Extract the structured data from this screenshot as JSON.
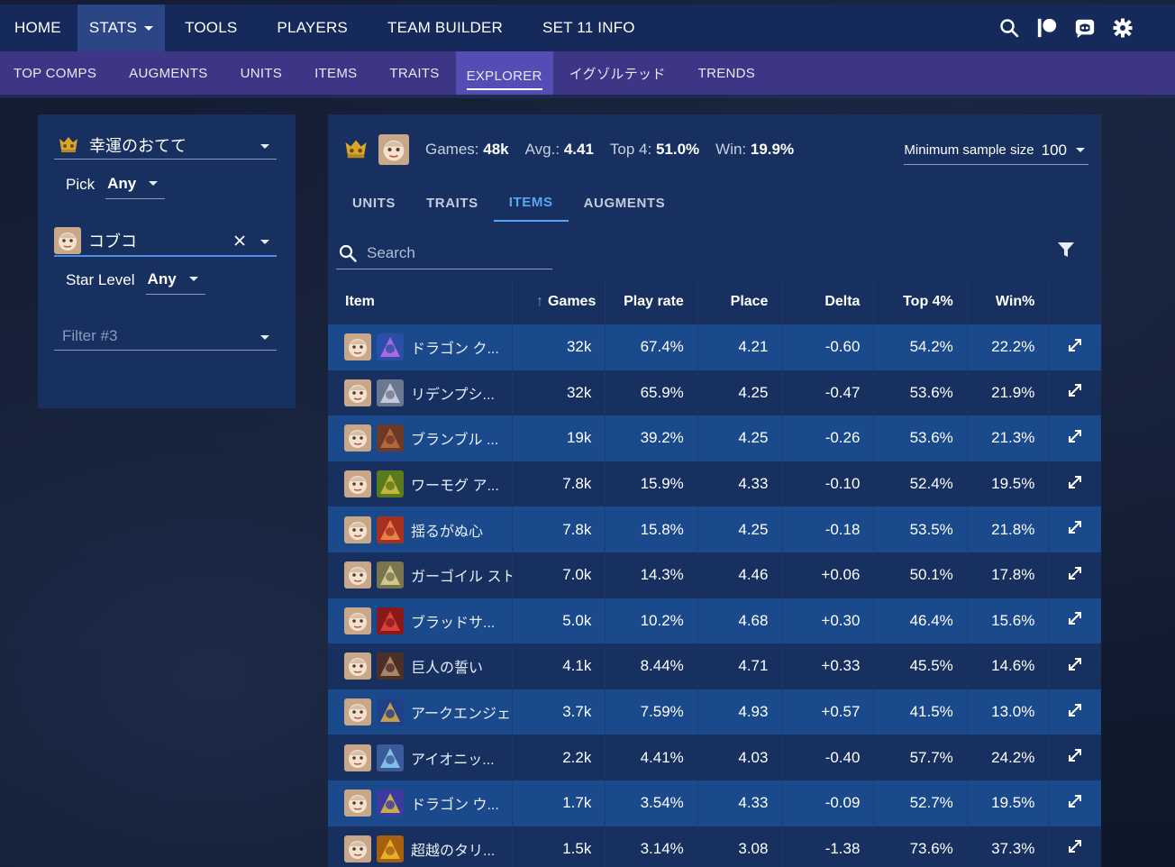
{
  "topnav": {
    "items": [
      {
        "label": "HOME",
        "active": false
      },
      {
        "label": "STATS",
        "active": true
      },
      {
        "label": "TOOLS",
        "active": false
      },
      {
        "label": "PLAYERS",
        "active": false
      },
      {
        "label": "TEAM BUILDER",
        "active": false
      },
      {
        "label": "SET 11 INFO",
        "active": false
      }
    ],
    "icons": [
      "search-icon",
      "patreon-icon",
      "discord-icon",
      "gear-icon"
    ]
  },
  "subnav": {
    "items": [
      {
        "label": "TOP COMPS",
        "active": false
      },
      {
        "label": "AUGMENTS",
        "active": false
      },
      {
        "label": "UNITS",
        "active": false
      },
      {
        "label": "ITEMS",
        "active": false
      },
      {
        "label": "TRAITS",
        "active": false
      },
      {
        "label": "EXPLORER",
        "active": true
      },
      {
        "label": "イグゾルテッド",
        "active": false
      },
      {
        "label": "TRENDS",
        "active": false
      }
    ]
  },
  "filters": {
    "trait_select": "幸運のおてて",
    "pick_label": "Pick",
    "pick_value": "Any",
    "unit_select": "コブコ",
    "star_label": "Star Level",
    "star_value": "Any",
    "filter3_placeholder": "Filter #3"
  },
  "summary": {
    "games_label": "Games:",
    "games_value": "48k",
    "avg_label": "Avg.:",
    "avg_value": "4.41",
    "top4_label": "Top 4:",
    "top4_value": "51.0%",
    "win_label": "Win:",
    "win_value": "19.9%",
    "min_sample_label": "Minimum sample size",
    "min_sample_value": "100"
  },
  "tabs": [
    {
      "label": "UNITS",
      "active": false
    },
    {
      "label": "TRAITS",
      "active": false
    },
    {
      "label": "ITEMS",
      "active": true
    },
    {
      "label": "AUGMENTS",
      "active": false
    }
  ],
  "search": {
    "placeholder": "Search",
    "value": ""
  },
  "table": {
    "headers": {
      "item": "Item",
      "games": "Games",
      "playrate": "Play rate",
      "place": "Place",
      "delta": "Delta",
      "top4": "Top 4%",
      "win": "Win%"
    },
    "sort_column": "games",
    "rows": [
      {
        "name": "ドラゴン ク...",
        "games": "32k",
        "playrate": "67.4%",
        "place": "4.21",
        "delta": "-0.60",
        "top4": "54.2%",
        "win": "22.2%",
        "icon_color": "#2b4fa8",
        "icon_accent": "#c070e0"
      },
      {
        "name": "リデンプシ...",
        "games": "32k",
        "playrate": "65.9%",
        "place": "4.25",
        "delta": "-0.47",
        "top4": "53.6%",
        "win": "21.9%",
        "icon_color": "#6a7890",
        "icon_accent": "#d8d8e8"
      },
      {
        "name": "ブランブル ...",
        "games": "19k",
        "playrate": "39.2%",
        "place": "4.25",
        "delta": "-0.26",
        "top4": "53.6%",
        "win": "21.3%",
        "icon_color": "#6e3a28",
        "icon_accent": "#c07040"
      },
      {
        "name": "ワーモグ ア...",
        "games": "7.8k",
        "playrate": "15.9%",
        "place": "4.33",
        "delta": "-0.10",
        "top4": "52.4%",
        "win": "19.5%",
        "icon_color": "#5a7a20",
        "icon_accent": "#d8c040"
      },
      {
        "name": "揺るがぬ心",
        "games": "7.8k",
        "playrate": "15.8%",
        "place": "4.25",
        "delta": "-0.18",
        "top4": "53.5%",
        "win": "21.8%",
        "icon_color": "#a83020",
        "icon_accent": "#f09050"
      },
      {
        "name": "ガーゴイル スト",
        "games": "7.0k",
        "playrate": "14.3%",
        "place": "4.46",
        "delta": "+0.06",
        "top4": "50.1%",
        "win": "17.8%",
        "icon_color": "#7a7450",
        "icon_accent": "#e0d890"
      },
      {
        "name": "ブラッドサ...",
        "games": "5.0k",
        "playrate": "10.2%",
        "place": "4.68",
        "delta": "+0.30",
        "top4": "46.4%",
        "win": "15.6%",
        "icon_color": "#8a1a1a",
        "icon_accent": "#e84848"
      },
      {
        "name": "巨人の誓い",
        "games": "4.1k",
        "playrate": "8.44%",
        "place": "4.71",
        "delta": "+0.33",
        "top4": "45.5%",
        "win": "14.6%",
        "icon_color": "#4a3028",
        "icon_accent": "#c09070"
      },
      {
        "name": "アークエンジェ.",
        "games": "3.7k",
        "playrate": "7.59%",
        "place": "4.93",
        "delta": "+0.57",
        "top4": "41.5%",
        "win": "13.0%",
        "icon_color": "#20408a",
        "icon_accent": "#e0b040"
      },
      {
        "name": "アイオニッ...",
        "games": "2.2k",
        "playrate": "4.41%",
        "place": "4.03",
        "delta": "-0.40",
        "top4": "57.7%",
        "win": "24.2%",
        "icon_color": "#3a5a9a",
        "icon_accent": "#90d0f0"
      },
      {
        "name": "ドラゴン ウ...",
        "games": "1.7k",
        "playrate": "3.54%",
        "place": "4.33",
        "delta": "-0.09",
        "top4": "52.7%",
        "win": "19.5%",
        "icon_color": "#3a3aa0",
        "icon_accent": "#e0c040"
      },
      {
        "name": "超越のタリ...",
        "games": "1.5k",
        "playrate": "3.14%",
        "place": "3.08",
        "delta": "-1.38",
        "top4": "73.6%",
        "win": "37.3%",
        "icon_color": "#a86010",
        "icon_accent": "#f0c030"
      }
    ]
  },
  "colors": {
    "topbar": "#15295a",
    "subbar": "#3d3586",
    "accent": "#58a6f4",
    "panel": "#17305f",
    "row_highlight": "#1b4a8c"
  }
}
